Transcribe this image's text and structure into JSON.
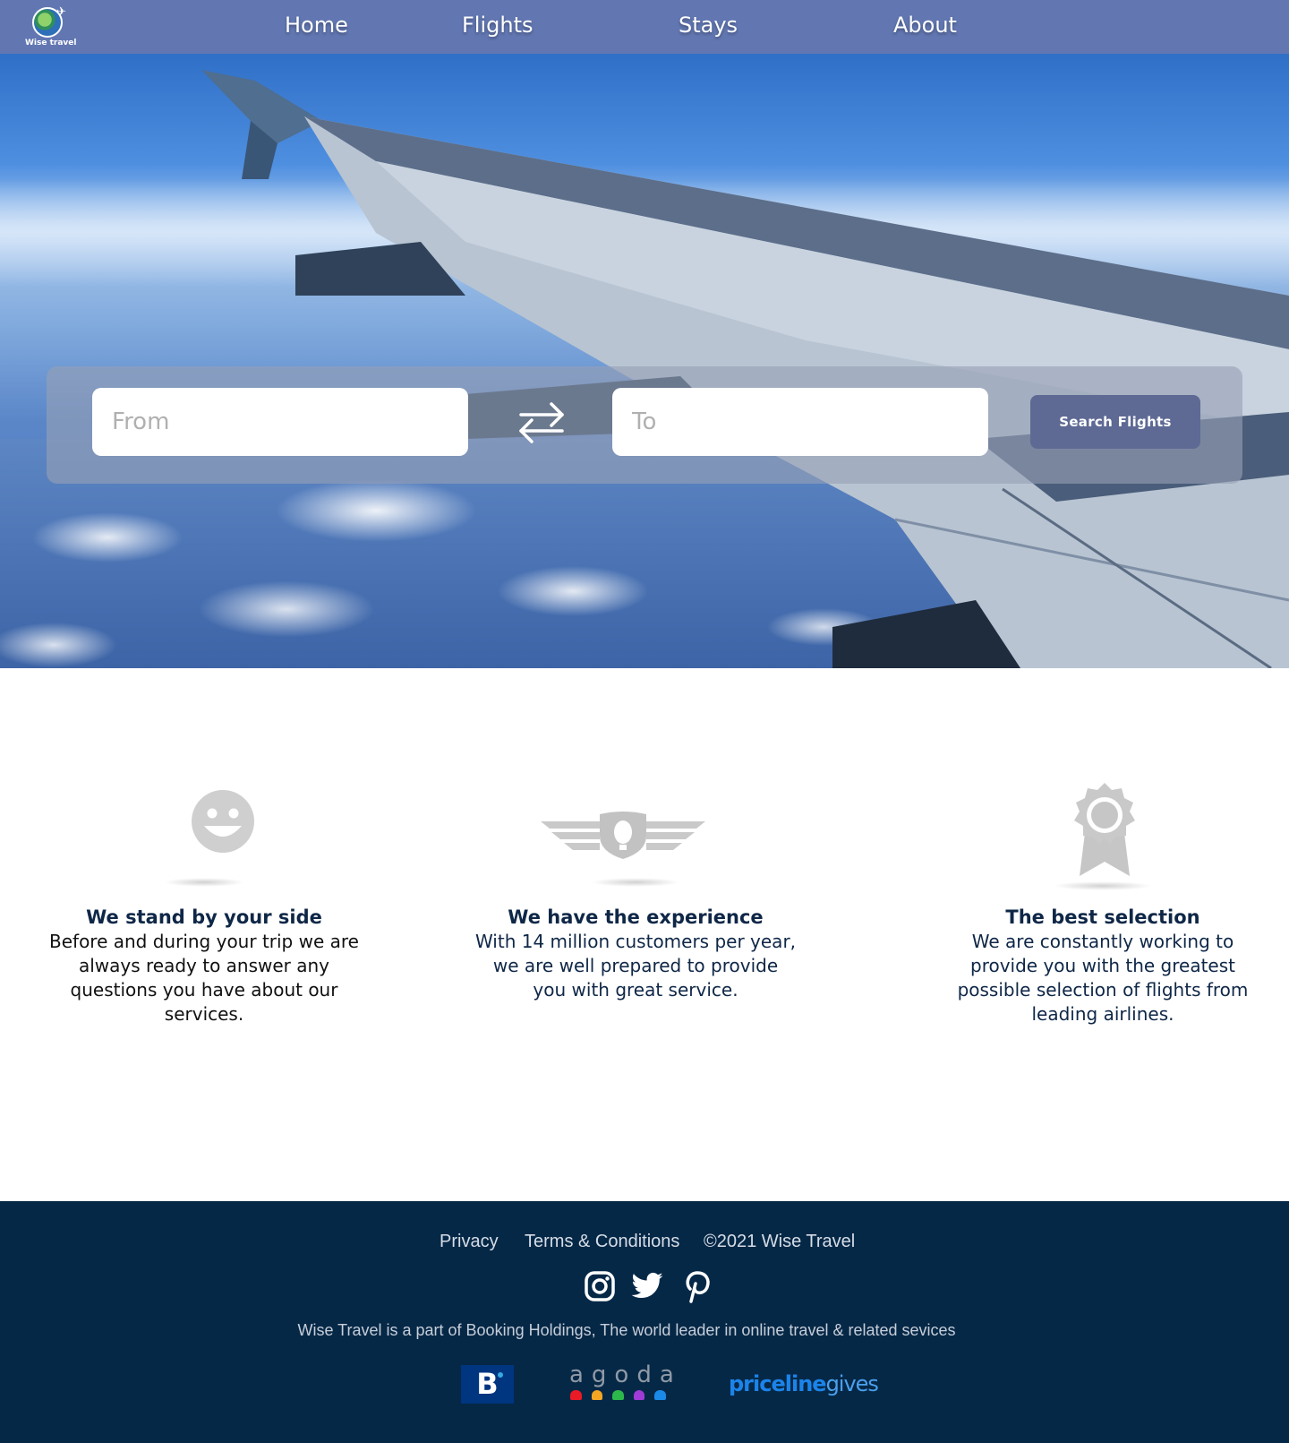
{
  "header": {
    "logo_text": "Wise travel",
    "nav": [
      {
        "label": "Home"
      },
      {
        "label": "Flights"
      },
      {
        "label": "Stays"
      },
      {
        "label": "About"
      }
    ]
  },
  "search": {
    "from_placeholder": "From",
    "to_placeholder": "To",
    "swap_icon": "swap-arrows-icon",
    "button_label": "Search  Flights"
  },
  "features": [
    {
      "icon": "smiley-icon",
      "title": "We stand by your side",
      "text": "Before and during your trip we are always ready to answer any questions you have about our services."
    },
    {
      "icon": "winged-shield-icon",
      "title": "We have the experience",
      "text": "With 14 million customers per year, we are well prepared to provide you with great service."
    },
    {
      "icon": "award-ribbon-icon",
      "title": "The best selection",
      "text": "We are constantly working to provide you with the greatest possible selection of flights from leading airlines."
    }
  ],
  "footer": {
    "links": [
      {
        "label": "Privacy"
      },
      {
        "label": "Terms & Conditions"
      },
      {
        "label": "©2021 Wise Travel"
      }
    ],
    "social": [
      "instagram-icon",
      "twitter-icon",
      "pinterest-icon"
    ],
    "about": "Wise Travel is a part of Booking Holdings, The world leader in online travel & related sevices",
    "partners": {
      "booking": "B",
      "agoda": "agoda",
      "priceline_a": "priceline",
      "priceline_b": "gives"
    }
  },
  "colors": {
    "header_bg": "#6277b2",
    "footer_bg": "#062847",
    "button_bg": "#5e6a94",
    "heading_text": "#0f2747"
  }
}
